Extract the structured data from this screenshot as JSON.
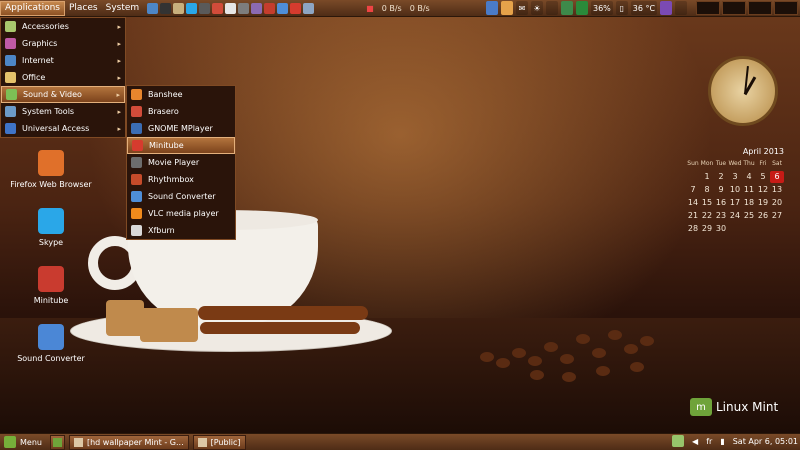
{
  "top_panel": {
    "menus": [
      "Applications",
      "Places",
      "System"
    ],
    "net_down": "0 B/s",
    "net_up": "0 B/s",
    "battery": "36%",
    "temperature": "36 °C"
  },
  "app_menu": {
    "items": [
      {
        "label": "Accessories",
        "icon": "accessories-icon",
        "color": "#a8c86d"
      },
      {
        "label": "Graphics",
        "icon": "graphics-icon",
        "color": "#c05aa6"
      },
      {
        "label": "Internet",
        "icon": "internet-icon",
        "color": "#4d86c6"
      },
      {
        "label": "Office",
        "icon": "office-icon",
        "color": "#e5c26b"
      },
      {
        "label": "Sound & Video",
        "icon": "sound-video-icon",
        "color": "#7dbf55"
      },
      {
        "label": "System Tools",
        "icon": "system-tools-icon",
        "color": "#6b9ac8"
      },
      {
        "label": "Universal Access",
        "icon": "universal-access-icon",
        "color": "#3f74c7"
      }
    ],
    "active_index": 4
  },
  "sub_menu": {
    "items": [
      {
        "label": "Banshee",
        "icon": "banshee-icon",
        "color": "#e8862d"
      },
      {
        "label": "Brasero",
        "icon": "brasero-icon",
        "color": "#d24c3a"
      },
      {
        "label": "GNOME MPlayer",
        "icon": "gnome-mplayer-icon",
        "color": "#3b6db4"
      },
      {
        "label": "Minitube",
        "icon": "minitube-icon",
        "color": "#d63b2e"
      },
      {
        "label": "Movie Player",
        "icon": "movie-player-icon",
        "color": "#6d6d6d"
      },
      {
        "label": "Rhythmbox",
        "icon": "rhythmbox-icon",
        "color": "#c54b2a"
      },
      {
        "label": "Sound Converter",
        "icon": "sound-converter-icon",
        "color": "#4e8ed8"
      },
      {
        "label": "VLC media player",
        "icon": "vlc-icon",
        "color": "#f08a1c"
      },
      {
        "label": "Xfburn",
        "icon": "xfburn-icon",
        "color": "#d9d9d9"
      }
    ],
    "active_index": 3
  },
  "desktop_icons": [
    {
      "label": "Firefox Web Browser",
      "icon": "firefox-icon",
      "color": "#e0702a"
    },
    {
      "label": "Skype",
      "icon": "skype-icon",
      "color": "#2aa7e8"
    },
    {
      "label": "Minitube",
      "icon": "minitube-icon",
      "color": "#c93b2f"
    },
    {
      "label": "Sound Converter",
      "icon": "sound-converter-icon",
      "color": "#4b87d6"
    }
  ],
  "calendar": {
    "title": "April 2013",
    "weekdays": [
      "Sun",
      "Mon",
      "Tue",
      "Wed",
      "Thu",
      "Fri",
      "Sat"
    ],
    "days": [
      "",
      "1",
      "2",
      "3",
      "4",
      "5",
      "6",
      "7",
      "8",
      "9",
      "10",
      "11",
      "12",
      "13",
      "14",
      "15",
      "16",
      "17",
      "18",
      "19",
      "20",
      "21",
      "22",
      "23",
      "24",
      "25",
      "26",
      "27",
      "28",
      "29",
      "30",
      "",
      "",
      "",
      ""
    ],
    "today": "6"
  },
  "branding": {
    "logo_text": "Linux Mint"
  },
  "bottom_panel": {
    "menu_label": "Menu",
    "tasks": [
      "[hd wallpaper Mint - G...",
      "[Public]"
    ],
    "keyboard_layout": "fr",
    "datetime": "Sat Apr  6, 05:01"
  }
}
